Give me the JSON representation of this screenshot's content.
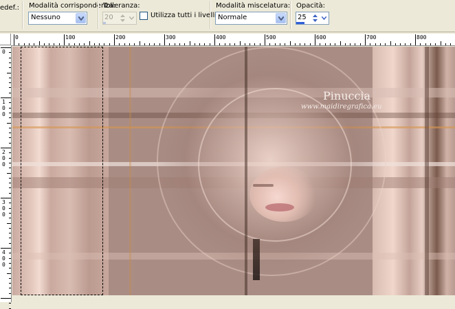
{
  "toolbar": {
    "cut_label": "edef.:",
    "match_mode": {
      "label": "Modalità corrispondenza:",
      "value": "Nessuno"
    },
    "tolerance": {
      "label": "Tolleranza:",
      "value": "20"
    },
    "use_all_layers": {
      "label": "Utilizza tutti i livelli",
      "checked": false
    },
    "blend_mode": {
      "label": "Modalità miscelatura:",
      "value": "Normale"
    },
    "opacity": {
      "label": "Opacità:",
      "value": "25",
      "fraction": 0.25
    }
  },
  "ruler": {
    "top_ticks": [
      "0",
      "100",
      "200",
      "300",
      "400",
      "500",
      "600",
      "700",
      "800"
    ],
    "left_ticks": [
      "0",
      "100",
      "200",
      "300",
      "400"
    ]
  },
  "canvas": {
    "watermark_title": "Pinuccia",
    "watermark_url": "www.maidiregrafica.eu"
  },
  "colors": {
    "accent_blue": "#2f5fd8",
    "canvas_base": "#a98d85"
  }
}
